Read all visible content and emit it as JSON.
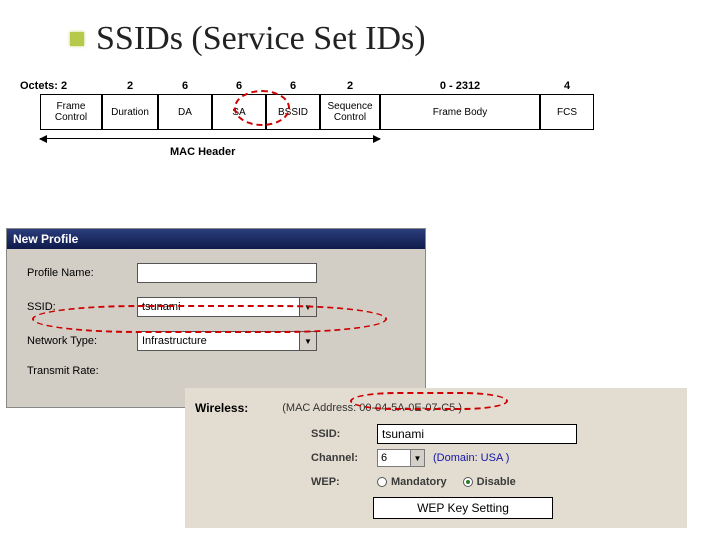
{
  "slide": {
    "title": "SSIDs (Service Set IDs)"
  },
  "frame": {
    "octets_label": "Octets: 2",
    "head": [
      "2",
      "6",
      "6",
      "6",
      "2",
      "0 - 2312",
      "4"
    ],
    "cells": [
      "Frame Control",
      "Duration",
      "DA",
      "SA",
      "BSSID",
      "Sequence Control",
      "Frame Body",
      "FCS"
    ],
    "mac_header": "MAC Header"
  },
  "profile": {
    "title": "New Profile",
    "labels": {
      "profile_name": "Profile Name:",
      "ssid": "SSID:",
      "network_type": "Network Type:",
      "transmit_rate": "Transmit Rate:"
    },
    "values": {
      "profile_name": "",
      "ssid": "tsunami",
      "network_type": "Infrastructure",
      "transmit_rate": ""
    }
  },
  "wireless": {
    "heading": "Wireless:",
    "mac_prefix": "(MAC Address: ",
    "mac_value": "00-04-5A-0E-07-C5",
    "mac_suffix": " )",
    "labels": {
      "ssid": "SSID:",
      "channel": "Channel:",
      "wep": "WEP:"
    },
    "ssid_value": "tsunami",
    "channel_value": "6",
    "domain": "(Domain: USA )",
    "wep_options": {
      "mandatory": "Mandatory",
      "disable": "Disable"
    },
    "wep_button": "WEP Key Setting"
  }
}
